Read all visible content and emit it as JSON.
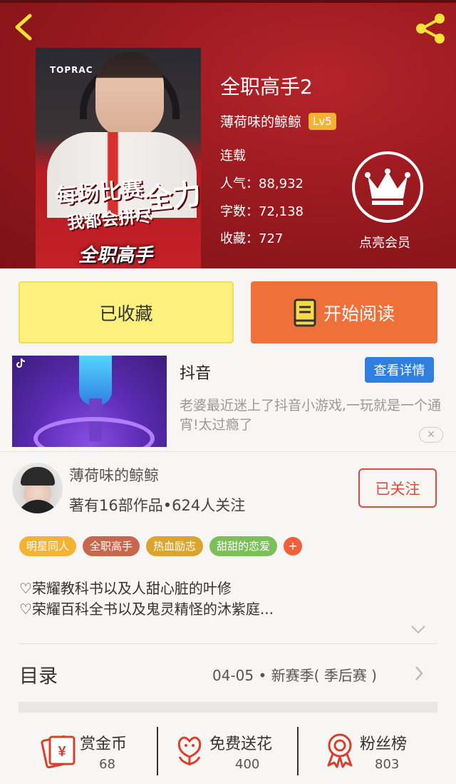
{
  "book": {
    "title": "全职高手2",
    "author": "薄荷味的鲸鲸",
    "level": "Lv5",
    "status": "连载",
    "popularity": "人气：88,932",
    "words": "字数：72,138",
    "favorites": "收藏：727",
    "vip_label": "点亮会员",
    "cover_brand": "TOPRAC",
    "cover_line1": "每场比赛",
    "cover_big": "全力",
    "cover_line2": "我都会拼尽",
    "cover_logo": "全职高手"
  },
  "actions": {
    "collected": "已收藏",
    "start_reading": "开始阅读"
  },
  "ad": {
    "title": "抖音",
    "detail_button": "查看详情",
    "description": "老婆最近迷上了抖音小游戏,一玩就是一个通宵!太过瘾了",
    "close": "✕"
  },
  "author_card": {
    "name": "薄荷味的鲸鲸",
    "works": "著有16部作品•624人关注",
    "follow_button": "已关注"
  },
  "tags": [
    {
      "label": "明星同人",
      "color": "#f5b335"
    },
    {
      "label": "全职高手",
      "color": "#c8674e"
    },
    {
      "label": "热血励志",
      "color": "#d9a52e"
    },
    {
      "label": "甜甜的恋爱",
      "color": "#7cbf5a"
    }
  ],
  "tag_more": "+",
  "intro": {
    "line1": "♡荣耀教科书以及人甜心脏的叶修",
    "line2": "♡荣耀百科全书以及鬼灵精怪的沐紫庭..."
  },
  "toc": {
    "label": "目录",
    "latest": "04-05 • 新赛季( 季后赛 )"
  },
  "bottom": {
    "reward_label": "赏金币",
    "reward_count": "68",
    "flower_label": "免费送花",
    "flower_count": "400",
    "fans_label": "粉丝榜",
    "fans_count": "803"
  },
  "colors": {
    "header_red": "#9a1a1f",
    "accent_orange": "#f0703a",
    "collected_yellow": "#fdf07c",
    "follow_red": "#e04b3a",
    "detail_blue": "#2f7fe0",
    "icon_red": "#d8402c"
  },
  "icons": [
    "back-icon",
    "share-icon",
    "crown-icon",
    "book-icon",
    "close-icon",
    "chevron-down-icon",
    "chevron-right-icon",
    "coin-icon",
    "flower-icon",
    "medal-icon"
  ]
}
